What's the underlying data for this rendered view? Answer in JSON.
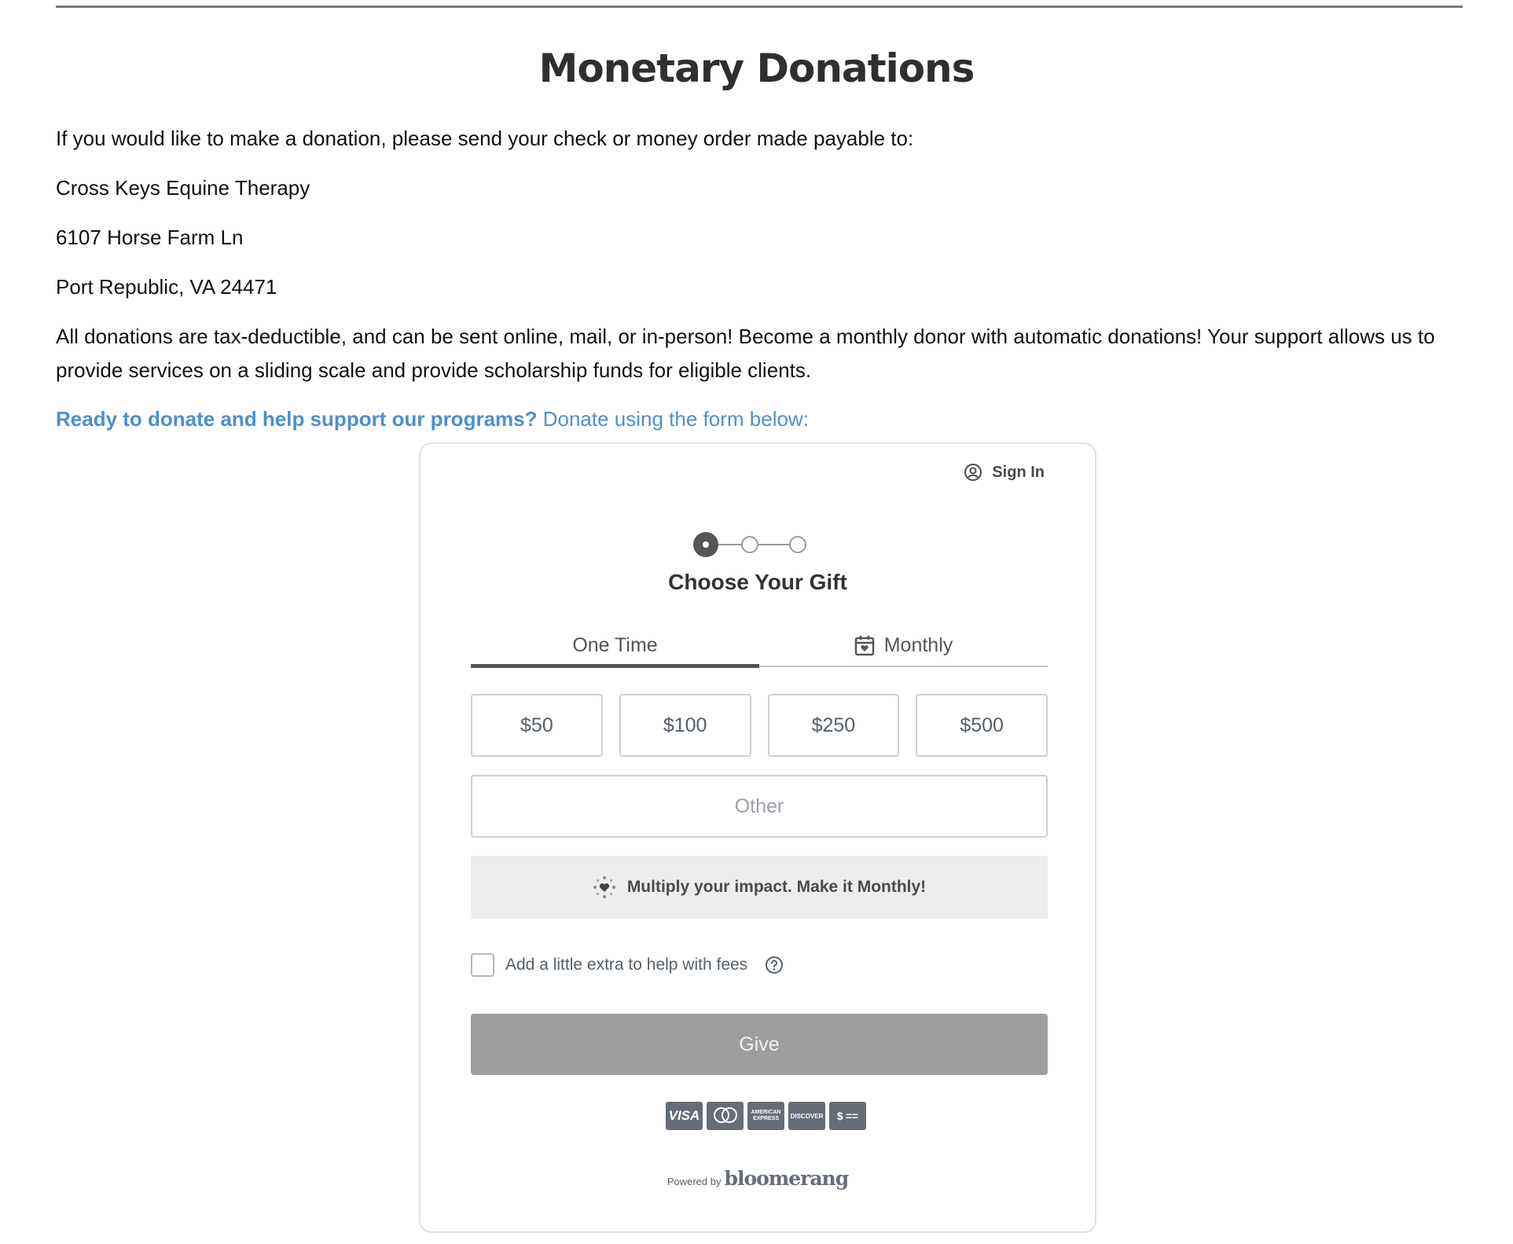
{
  "page": {
    "title": "Monetary Donations",
    "intro": "If you would like to make a donation, please send your check or money order made payable to:",
    "address_name": "Cross Keys Equine Therapy",
    "address_street": "6107 Horse Farm Ln",
    "address_city": "Port Republic, VA 24471",
    "info": "All donations are tax-deductible, and can be sent online, mail, or in-person! Become a monthly donor with automatic donations! Your support allows us to provide services on a sliding scale and provide scholarship funds for eligible clients.",
    "cta_bold": "Ready to donate and help support our programs?",
    "cta_rest": "Donate using the form below:"
  },
  "form": {
    "sign_in": "Sign In",
    "step_title": "Choose Your Gift",
    "tabs": [
      {
        "label": "One Time",
        "active": true
      },
      {
        "label": "Monthly",
        "active": false
      }
    ],
    "amounts": [
      "$50",
      "$100",
      "$250",
      "$500"
    ],
    "other_placeholder": "Other",
    "monthly_banner": "Multiply your impact. Make it Monthly!",
    "fees_label": "Add a little extra to help with fees",
    "fees_checked": false,
    "give_label": "Give",
    "cards": [
      "VISA",
      "mastercard",
      "AMERICAN EXPRESS",
      "DISCOVER",
      "$"
    ],
    "powered_by": "Powered by",
    "brand": "bloomerang"
  },
  "colors": {
    "link": "#4d8fd0",
    "give_button": "#9e9e9f",
    "banner_bg": "#ededeb"
  }
}
